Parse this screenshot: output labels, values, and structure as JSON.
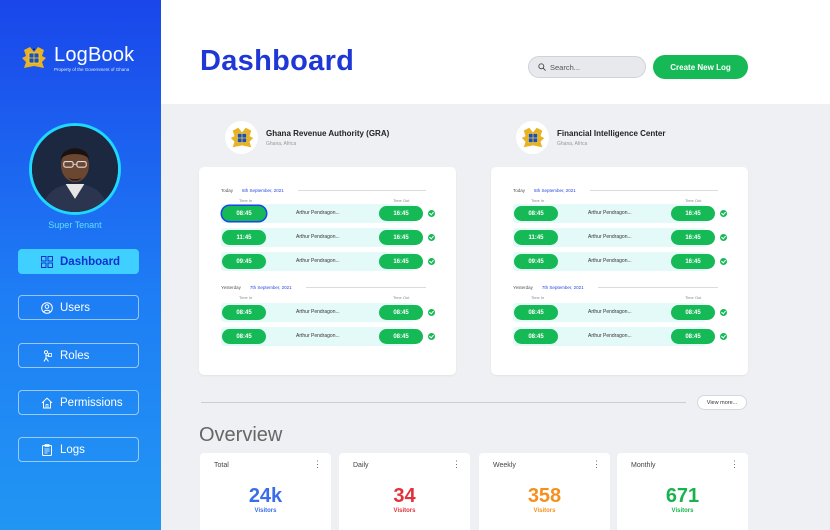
{
  "sidebar": {
    "brand_name": "LogBook",
    "brand_subtitle": "Property of the Government of Ghana",
    "role_label": "Super Tenant",
    "nav": [
      {
        "label": "Dashboard",
        "icon": "dashboard-icon",
        "active": true
      },
      {
        "label": "Users",
        "icon": "user-icon",
        "active": false
      },
      {
        "label": "Roles",
        "icon": "roles-icon",
        "active": false
      },
      {
        "label": "Permissions",
        "icon": "home-icon",
        "active": false
      },
      {
        "label": "Logs",
        "icon": "clipboard-icon",
        "active": false
      }
    ]
  },
  "header": {
    "title": "Dashboard",
    "search_placeholder": "Search...",
    "create_label": "Create New Log"
  },
  "orgs": [
    {
      "name": "Ghana Revenue Authority (GRA)",
      "location": "Ghana, Africa",
      "today_label": "Today",
      "today_date": "6th September, 2021",
      "yesterday_label": "Yesterday",
      "yesterday_date": "7th September, 2021",
      "col_in": "Time In",
      "col_out": "Time Out",
      "today_rows": [
        {
          "in": "08:45",
          "name": "Arthur Pendragon...",
          "out": "16:45"
        },
        {
          "in": "11:45",
          "name": "Arthur Pendragon...",
          "out": "16:45"
        },
        {
          "in": "09:45",
          "name": "Arthur Pendragon...",
          "out": "16:45"
        }
      ],
      "yesterday_rows": [
        {
          "in": "08:45",
          "name": "Arthur Pendragon...",
          "out": "08:45"
        },
        {
          "in": "08:45",
          "name": "Arthur Pendragon...",
          "out": "08:45"
        }
      ]
    },
    {
      "name": "Financial Intelligence Center",
      "location": "Ghana, Africa",
      "today_label": "Today",
      "today_date": "6th September, 2021",
      "yesterday_label": "Yesterday",
      "yesterday_date": "7th September, 2021",
      "col_in": "Time In",
      "col_out": "Time Out",
      "today_rows": [
        {
          "in": "08:45",
          "name": "Arthur Pendragon...",
          "out": "16:45"
        },
        {
          "in": "11:45",
          "name": "Arthur Pendragon...",
          "out": "16:45"
        },
        {
          "in": "09:45",
          "name": "Arthur Pendragon...",
          "out": "16:45"
        }
      ],
      "yesterday_rows": [
        {
          "in": "08:45",
          "name": "Arthur Pendragon...",
          "out": "08:45"
        },
        {
          "in": "08:45",
          "name": "Arthur Pendragon...",
          "out": "08:45"
        }
      ]
    }
  ],
  "view_more_label": "View more...",
  "overview": {
    "title": "Overview",
    "stats": [
      {
        "label": "Total",
        "value": "24k",
        "sub": "Visitors",
        "color": "#3a6ee8"
      },
      {
        "label": "Daily",
        "value": "34",
        "sub": "Visitors",
        "color": "#e0323c"
      },
      {
        "label": "Weekly",
        "value": "358",
        "sub": "Visitors",
        "color": "#f5901e"
      },
      {
        "label": "Monthly",
        "value": "671",
        "sub": "Visitors",
        "color": "#18b34f"
      }
    ]
  }
}
